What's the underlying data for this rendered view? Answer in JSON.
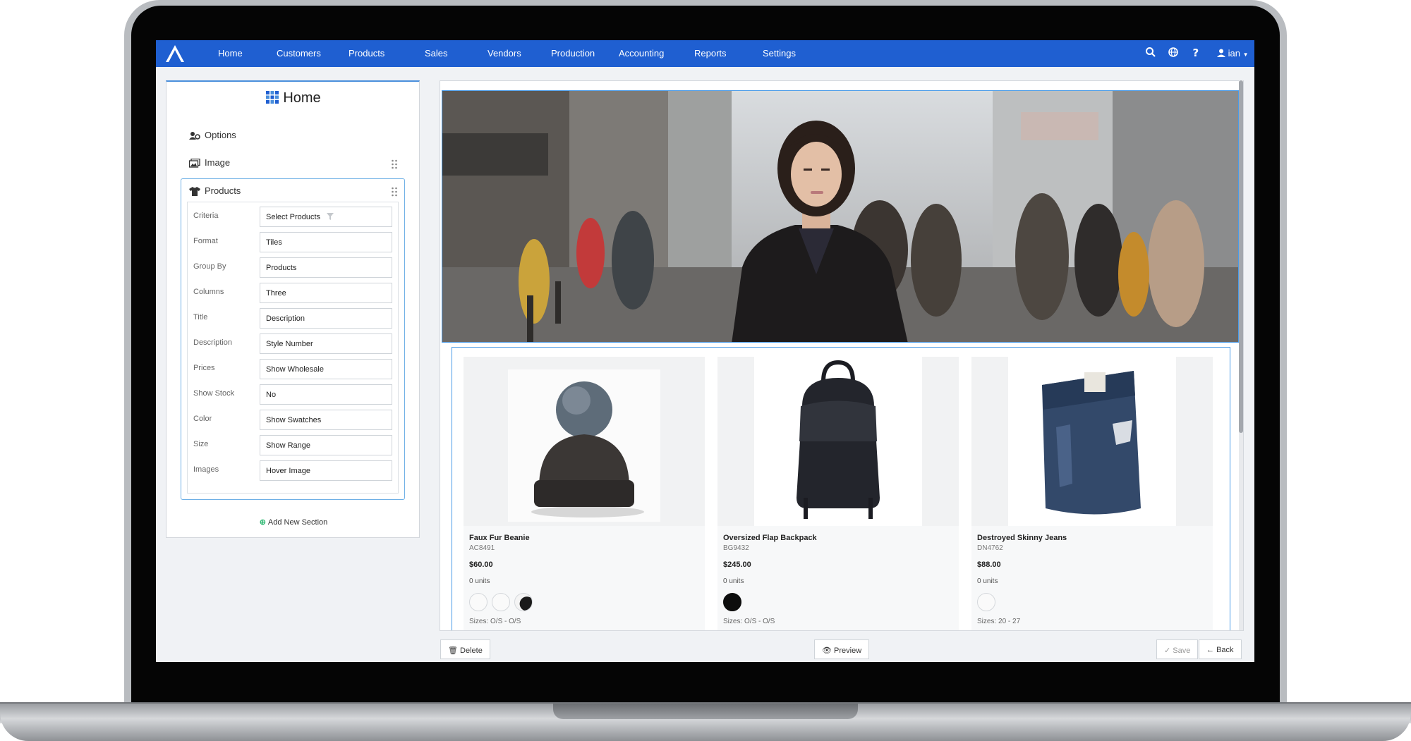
{
  "navbar": {
    "items": [
      "Home",
      "Customers",
      "Products",
      "Sales",
      "Vendors",
      "Production",
      "Accounting",
      "Reports",
      "Settings"
    ],
    "user": "ian",
    "accent_color": "#1f5fd1"
  },
  "left_panel": {
    "title": "Home",
    "sections": [
      {
        "label": "Options",
        "icon": "users-cog-icon"
      },
      {
        "label": "Image",
        "icon": "images-icon"
      },
      {
        "label": "Products",
        "icon": "tshirt-icon"
      }
    ],
    "fields": [
      {
        "label": "Criteria",
        "value": "Select Products"
      },
      {
        "label": "Format",
        "value": "Tiles"
      },
      {
        "label": "Group By",
        "value": "Products"
      },
      {
        "label": "Columns",
        "value": "Three"
      },
      {
        "label": "Title",
        "value": "Description"
      },
      {
        "label": "Description",
        "value": "Style Number"
      },
      {
        "label": "Prices",
        "value": "Show Wholesale"
      },
      {
        "label": "Show Stock",
        "value": "No"
      },
      {
        "label": "Color",
        "value": "Show Swatches"
      },
      {
        "label": "Size",
        "value": "Show Range"
      },
      {
        "label": "Images",
        "value": "Hover Image"
      }
    ],
    "add_section": "Add New Section"
  },
  "products": [
    {
      "name": "Faux Fur Beanie",
      "code": "AC8491",
      "price": "$60.00",
      "units": "0 units",
      "sizes": "Sizes: O/S - O/S"
    },
    {
      "name": "Oversized Flap Backpack",
      "code": "BG9432",
      "price": "$245.00",
      "units": "0 units",
      "sizes": "Sizes: O/S - O/S"
    },
    {
      "name": "Destroyed Skinny Jeans",
      "code": "DN4762",
      "price": "$88.00",
      "units": "0 units",
      "sizes": "Sizes: 20 - 27"
    }
  ],
  "footer": {
    "delete": "Delete",
    "preview": "Preview",
    "save": "Save",
    "back": "Back"
  }
}
